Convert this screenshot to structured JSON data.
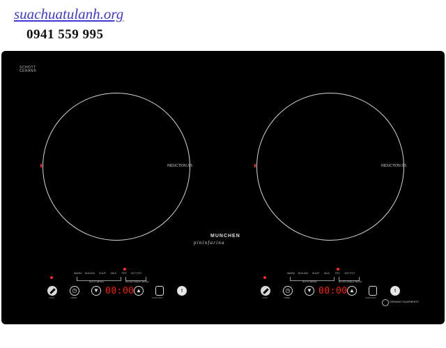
{
  "watermark": {
    "site": "suachuatulanh.org",
    "phone": "0941 559 995"
  },
  "cooktop": {
    "badge": "SCHOTT CERAN®",
    "brand": "MUNCHEN",
    "brand_sub": "pininfarina",
    "zones": [
      {
        "label": "INDUCTION",
        "power": "3.5"
      },
      {
        "label": "INDUCTION",
        "power": "3.5"
      }
    ],
    "panels": [
      {
        "modes": [
          "WARM",
          "BOILING",
          "SOUP",
          "MILK",
          "FRY",
          "HOT POT"
        ],
        "auto_menu": "AUTO MENU",
        "adjustable": "ADJUSTABLE MENU",
        "display": "00:00",
        "button_labels": [
          "LOCK",
          "TIMER",
          "",
          "",
          "FUNCTION",
          ""
        ]
      },
      {
        "modes": [
          "WARM",
          "BOILING",
          "SOUP",
          "MILK",
          "FRY",
          "HOT POT"
        ],
        "auto_menu": "AUTO MENU",
        "adjustable": "ADJUSTABLE MENU",
        "display": "00:00",
        "button_labels": [
          "LOCK",
          "TIMER",
          "",
          "",
          "FUNCTION",
          ""
        ]
      }
    ],
    "certificate": "GERMANY EQUIPMENTS"
  }
}
